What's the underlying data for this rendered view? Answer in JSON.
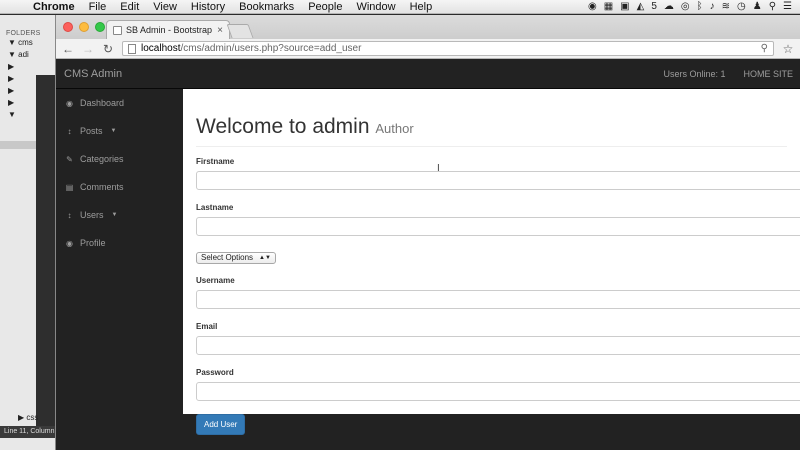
{
  "menubar": {
    "app": "Chrome",
    "items": [
      "File",
      "Edit",
      "View",
      "History",
      "Bookmarks",
      "People",
      "Window",
      "Help"
    ],
    "status_badge": "5"
  },
  "editor": {
    "folders_label": "FOLDERS",
    "tree": [
      "▼ cms",
      "▼ adi",
      "▶",
      "▶",
      "▶",
      "▶",
      "▼"
    ],
    "tree_bottom": "▶ css",
    "status": "Line 11, Column"
  },
  "browser": {
    "tab_title": "SB Admin - Bootstrap Adm",
    "tab_close": "×",
    "url_host": "localhost",
    "url_path": "/cms/admin/users.php?source=add_user"
  },
  "page": {
    "brand": "CMS Admin",
    "users_online": "Users Online: 1",
    "home_site": "HOME SITE",
    "sidebar": [
      {
        "icon": "dashboard-icon",
        "glyph": "◉",
        "label": "Dashboard",
        "caret": ""
      },
      {
        "icon": "arrows-v-icon",
        "glyph": "↕",
        "label": "Posts",
        "caret": "▼"
      },
      {
        "icon": "wrench-icon",
        "glyph": "✎",
        "label": "Categories",
        "caret": ""
      },
      {
        "icon": "file-icon",
        "glyph": "▤",
        "label": "Comments",
        "caret": ""
      },
      {
        "icon": "arrows-v-icon",
        "glyph": "↕",
        "label": "Users",
        "caret": "▼"
      },
      {
        "icon": "dashboard-icon",
        "glyph": "◉",
        "label": "Profile",
        "caret": ""
      }
    ],
    "heading": "Welcome to admin",
    "heading_small": "Author",
    "form": {
      "firstname_label": "Firstname",
      "lastname_label": "Lastname",
      "select_value": "Select Options",
      "username_label": "Username",
      "email_label": "Email",
      "password_label": "Password",
      "submit_label": "Add User"
    }
  },
  "colors": {
    "navbar_bg": "#222222",
    "nav_text": "#9d9d9d",
    "primary_button": "#337ab7"
  }
}
